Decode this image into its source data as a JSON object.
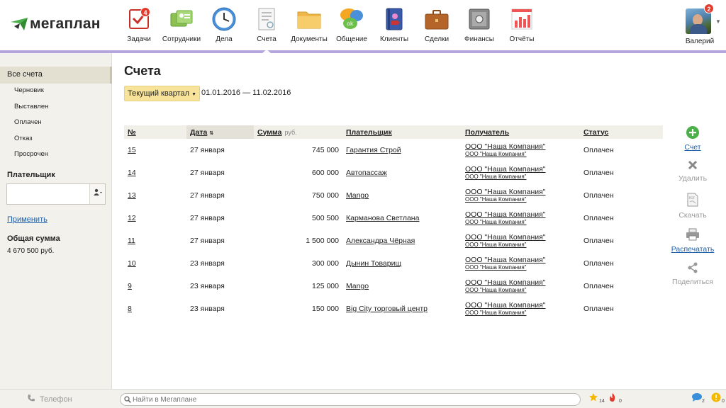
{
  "app": {
    "logo": "мегаплан",
    "modules": [
      {
        "id": "tasks",
        "label": "Задачи",
        "badge": "4"
      },
      {
        "id": "staff",
        "label": "Сотрудники"
      },
      {
        "id": "affairs",
        "label": "Дела"
      },
      {
        "id": "invoices",
        "label": "Счета",
        "active": true
      },
      {
        "id": "documents",
        "label": "Документы"
      },
      {
        "id": "chat",
        "label": "Общение"
      },
      {
        "id": "clients",
        "label": "Клиенты"
      },
      {
        "id": "deals",
        "label": "Сделки"
      },
      {
        "id": "finance",
        "label": "Финансы"
      },
      {
        "id": "reports",
        "label": "Отчёты"
      }
    ],
    "user": {
      "name": "Валерий",
      "badge": "2"
    }
  },
  "sidebar": {
    "active": "Все счета",
    "items": [
      "Черновик",
      "Выставлен",
      "Оплачен",
      "Отказ",
      "Просрочен"
    ],
    "payer_title": "Плательщик",
    "payer_value": "",
    "apply": "Применить",
    "total_title": "Общая сумма",
    "total_value": "4 670 500 руб."
  },
  "main": {
    "title": "Счета",
    "period_label": "Текущий квартал",
    "period_range": "01.01.2016 — 11.02.2016",
    "columns": {
      "num": "№",
      "date": "Дата",
      "sum": "Сумма",
      "currency": "руб.",
      "payer": "Плательщик",
      "receiver": "Получатель",
      "status": "Статус"
    },
    "rows": [
      {
        "num": "15",
        "date": "27 января",
        "sum": "745 000",
        "payer": "Гарантия Строй",
        "receiver": "ООО \"Наша Компания\"",
        "receiver_sub": "ООО \"Наша Компания\"",
        "status": "Оплачен"
      },
      {
        "num": "14",
        "date": "27 января",
        "sum": "600 000",
        "payer": "Автопассаж",
        "receiver": "ООО \"Наша Компания\"",
        "receiver_sub": "ООО \"Наша Компания\"",
        "status": "Оплачен"
      },
      {
        "num": "13",
        "date": "27 января",
        "sum": "750 000",
        "payer": "Mango",
        "receiver": "ООО \"Наша Компания\"",
        "receiver_sub": "ООО \"Наша Компания\"",
        "status": "Оплачен"
      },
      {
        "num": "12",
        "date": "27 января",
        "sum": "500 500",
        "payer": "Карманова Светлана",
        "receiver": "ООО \"Наша Компания\"",
        "receiver_sub": "ООО \"Наша Компания\"",
        "status": "Оплачен"
      },
      {
        "num": "11",
        "date": "27 января",
        "sum": "1 500 000",
        "payer": "Александра Чёрная",
        "receiver": "ООО \"Наша Компания\"",
        "receiver_sub": "ООО \"Наша Компания\"",
        "status": "Оплачен"
      },
      {
        "num": "10",
        "date": "23 января",
        "sum": "300 000",
        "payer": "Дынин Товарищ",
        "receiver": "ООО \"Наша Компания\"",
        "receiver_sub": "ООО \"Наша Компания\"",
        "status": "Оплачен"
      },
      {
        "num": "9",
        "date": "23 января",
        "sum": "125 000",
        "payer": "Mango",
        "receiver": "ООО \"Наша Компания\"",
        "receiver_sub": "ООО \"Наша Компания\"",
        "status": "Оплачен"
      },
      {
        "num": "8",
        "date": "23 января",
        "sum": "150 000",
        "payer": "Big City торговый центр",
        "receiver": "ООО \"Наша Компания\"",
        "receiver_sub": "ООО \"Наша Компания\"",
        "status": "Оплачен"
      }
    ]
  },
  "actions": {
    "new": "Счет",
    "delete": "Удалить",
    "download": "Скачать",
    "print": "Распечатать",
    "share": "Поделиться"
  },
  "bottom": {
    "phone": "Телефон",
    "search_placeholder": "Найти в Мегаплане",
    "favorites_count": "14",
    "hot_count": "0",
    "messages_count": "2",
    "alerts_count": "0"
  },
  "colors": {
    "accent_line": "#b4a6dc",
    "period_button": "#f7e49a",
    "link": "#1f5fa8",
    "badge": "#e23b2e"
  }
}
